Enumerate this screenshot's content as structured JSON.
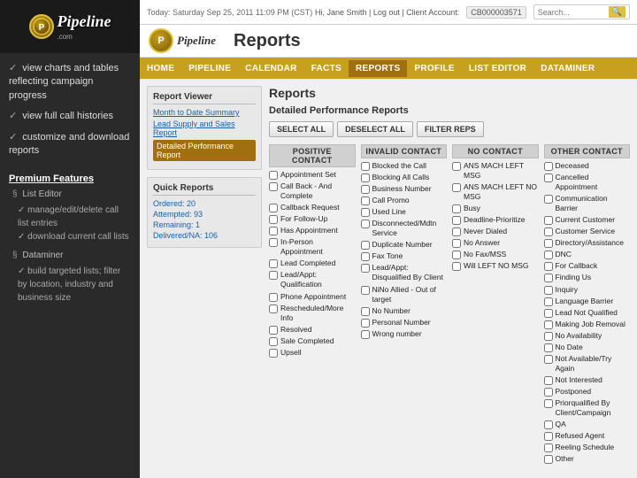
{
  "sidebar": {
    "logo_letter": "P",
    "logo_text": "Pipeline",
    "logo_sub": ".com",
    "items": [
      {
        "id": "view-charts",
        "label": "view charts and tables reflecting campaign progress"
      },
      {
        "id": "view-histories",
        "label": "view full call histories"
      },
      {
        "id": "customize",
        "label": "customize and download reports"
      }
    ],
    "premium": {
      "title": "Premium Features",
      "sections": [
        {
          "id": "list-editor",
          "label": "List Editor",
          "sub_items": [
            "manage/edit/delete call list entries",
            "download current call lists"
          ]
        },
        {
          "id": "dataminer",
          "label": "Dataminer",
          "sub_items": [
            "build targeted lists; filter by location, industry and business size"
          ]
        }
      ]
    }
  },
  "topbar": {
    "date": "Today: Saturday Sep 25, 2011 11:09 PM (CST)",
    "user": "Hi, Jane Smith | Log out | Client Account:",
    "account": "CB000003571",
    "search_placeholder": "Search..."
  },
  "page_title": "Reports",
  "main_logo_text": "Pipeline",
  "navbar": {
    "items": [
      "HOME",
      "PIPELINE",
      "CALENDAR",
      "FACTS",
      "REPORTS",
      "PROFILE",
      "LIST EDITOR",
      "DATAMINER"
    ]
  },
  "left_panel": {
    "report_viewer": {
      "title": "Report Viewer",
      "links": [
        {
          "id": "month-date",
          "label": "Month to Date Summary",
          "active": false
        },
        {
          "id": "lead-supply",
          "label": "Lead Supply and Sales Report",
          "active": false
        },
        {
          "id": "detailed",
          "label": "Detailed Performance Report",
          "active": true
        }
      ]
    },
    "quick_reports": {
      "title": "Quick Reports",
      "stats": [
        {
          "label": "Ordered:",
          "value": "20"
        },
        {
          "label": "Attempted:",
          "value": "93"
        },
        {
          "label": "Remaining:",
          "value": "1"
        },
        {
          "label": "Delivered/NA:",
          "value": "106"
        }
      ]
    }
  },
  "reports": {
    "title": "Reports",
    "subtitle": "Detailed Performance Reports",
    "btn_select_all": "SELECT ALL",
    "btn_deselect_all": "DESELECT ALL",
    "btn_filter_reps": "FILTER REPS",
    "columns": [
      {
        "id": "positive-contact",
        "header": "POSITIVE CONTACT",
        "items": [
          "Appointment Set",
          "Call Back - And Complete",
          "Callback Request",
          "For Follow-Up",
          "Has Appointment",
          "In-Person Appointment",
          "Lead Completed",
          "Lead/Appt: Qualification",
          "Phone Appointment",
          "Rescheduled/More Info",
          "Resolved",
          "Sale Completed",
          "Upsell"
        ]
      },
      {
        "id": "invalid-contact",
        "header": "INVALID CONTACT",
        "items": [
          "Blocked the Call",
          "Blocking All Calls",
          "Business Number",
          "Call Promo",
          "Used Line",
          "Disconnected/Mdtn Service",
          "Duplicate Number",
          "Fax Tone",
          "Lead/Appt: Disqualified By Client",
          "NiNo Allied - Out of target",
          "No Number",
          "Personal Number",
          "Wrong number"
        ]
      },
      {
        "id": "no-contact",
        "header": "NO CONTACT",
        "items": [
          "ANS MACH LEFT MSG",
          "ANS MACH LEFT NO MSG",
          "Busy",
          "Deadline-Prioritize",
          "Never Dialed",
          "No Answer",
          "No Fax/MSS",
          "Will LEFT NO MSG"
        ]
      },
      {
        "id": "other-contact",
        "header": "OTHER CONTACT",
        "items": [
          "Deceased",
          "Cancelled Appointment",
          "Communication Barrier",
          "Current Customer",
          "Customer Service",
          "Directory/Assistance",
          "DNC",
          "For Callback",
          "Finding Us",
          "Inquiry",
          "Language Barrier",
          "Lead Not Qualified",
          "Making Job Removal",
          "No Availability",
          "No Date",
          "Not Available/Try Again",
          "Not Interested",
          "Postponed",
          "Priorqualified By Client/Campaign",
          "QA",
          "Refused Agent",
          "Reeling Schedule",
          "Other"
        ]
      }
    ]
  }
}
